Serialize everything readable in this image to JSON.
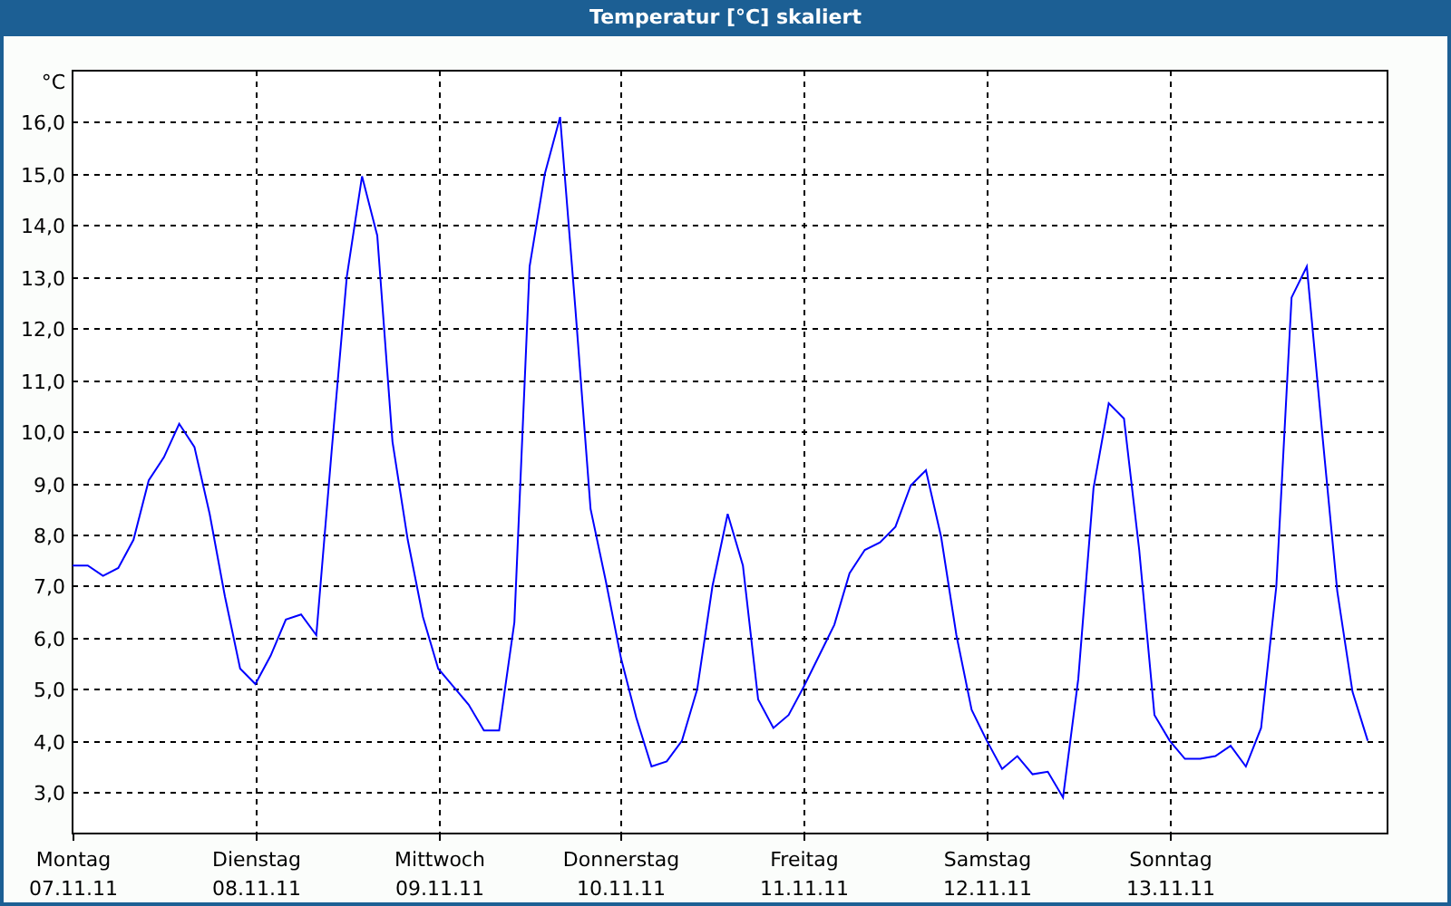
{
  "window": {
    "title": "Temperatur [°C] skaliert"
  },
  "chart": {
    "tick_dates": [
      "07.11.11",
      "08.11.11",
      "09.11.11",
      "10.11.11",
      "11.11.11",
      "12.11.11",
      "13.11.11"
    ],
    "chart_data": {
      "type": "line",
      "grid": true,
      "ylabel": "°C",
      "ylim": [
        2.2,
        17.0
      ],
      "yticks": [
        {
          "value": 3,
          "label": "3,0"
        },
        {
          "value": 4,
          "label": "4,0"
        },
        {
          "value": 5,
          "label": "5,0"
        },
        {
          "value": 6,
          "label": "6,0"
        },
        {
          "value": 7,
          "label": "7,0"
        },
        {
          "value": 8,
          "label": "8,0"
        },
        {
          "value": 9,
          "label": "9,0"
        },
        {
          "value": 10,
          "label": "10,0"
        },
        {
          "value": 11,
          "label": "11,0"
        },
        {
          "value": 12,
          "label": "12,0"
        },
        {
          "value": 13,
          "label": "13,0"
        },
        {
          "value": 14,
          "label": "14,0"
        },
        {
          "value": 15,
          "label": "15,0"
        },
        {
          "value": 16,
          "label": "16,0"
        }
      ],
      "categories": [
        "Montag",
        null,
        null,
        null,
        null,
        null,
        null,
        null,
        null,
        null,
        null,
        null,
        "Dienstag",
        null,
        null,
        null,
        null,
        null,
        null,
        null,
        null,
        null,
        null,
        null,
        "Mittwoch",
        null,
        null,
        null,
        null,
        null,
        null,
        null,
        null,
        null,
        null,
        null,
        "Donnerstag",
        null,
        null,
        null,
        null,
        null,
        null,
        null,
        null,
        null,
        null,
        null,
        "Freitag",
        null,
        null,
        null,
        null,
        null,
        null,
        null,
        null,
        null,
        null,
        null,
        "Samstag",
        null,
        null,
        null,
        null,
        null,
        null,
        null,
        null,
        null,
        null,
        null,
        "Sonntag",
        null,
        null,
        null,
        null,
        null,
        null,
        null,
        null,
        null,
        null,
        null,
        null,
        null
      ],
      "series": [
        {
          "color": "#0000ff",
          "values": [
            7.4,
            7.4,
            7.2,
            7.35,
            7.9,
            9.05,
            9.5,
            10.15,
            9.7,
            8.4,
            6.8,
            5.4,
            5.1,
            5.65,
            6.35,
            6.45,
            6.05,
            9.6,
            13.0,
            14.95,
            13.8,
            9.8,
            7.9,
            6.4,
            5.4,
            5.05,
            4.7,
            4.2,
            4.2,
            6.3,
            13.2,
            15.0,
            16.1,
            12.4,
            8.5,
            7.1,
            5.6,
            4.45,
            3.5,
            3.6,
            4.0,
            5.0,
            7.0,
            8.4,
            7.4,
            4.8,
            4.25,
            4.5,
            5.05,
            5.65,
            6.25,
            7.25,
            7.7,
            7.85,
            8.15,
            8.95,
            9.25,
            7.95,
            6.05,
            4.6,
            4.0,
            3.45,
            3.7,
            3.35,
            3.4,
            2.9,
            5.2,
            8.9,
            10.55,
            10.25,
            7.7,
            4.5,
            4.0,
            3.65,
            3.65,
            3.7,
            3.9,
            3.5,
            4.25,
            7.0,
            12.6,
            13.2,
            10.0,
            6.9,
            4.95,
            4.0
          ]
        }
      ]
    }
  }
}
